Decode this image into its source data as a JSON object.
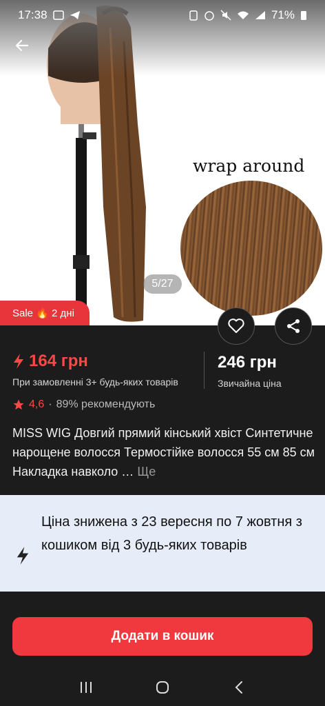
{
  "status_bar": {
    "time": "17:38",
    "battery": "71%"
  },
  "hero": {
    "image_caption": "wrap around",
    "page_indicator": "5/27",
    "sale_badge": "Sale 🔥 2 дні"
  },
  "price": {
    "sale_price": "164 грн",
    "sale_note": "При замовленні 3+ будь-яких товарів",
    "regular_price": "246 грн",
    "regular_note": "Звичайна ціна"
  },
  "rating": {
    "value": "4,6",
    "separator": "·",
    "recommend": "89% рекомендують"
  },
  "product": {
    "title": "MISS WIG Довгий прямий кінський хвіст Синтетичне нарощене волосся Термостійке волосся 55 см 85 см Накладка навколо … ",
    "more_label": "Ще"
  },
  "promo": {
    "text": "Ціна знижена з 23 вересня по 7 жовтня з кошиком від 3 будь-яких товарів"
  },
  "cart_button": {
    "label": "Додати в кошик"
  },
  "colors": {
    "accent": "#f0393f",
    "price_red": "#ff4747",
    "promo_bg": "#e6ecf8",
    "background": "#1c1c1c"
  },
  "icons": [
    "back-arrow-icon",
    "heart-icon",
    "share-icon",
    "star-icon",
    "lightning-icon",
    "recents-icon",
    "home-icon",
    "back-nav-icon"
  ]
}
